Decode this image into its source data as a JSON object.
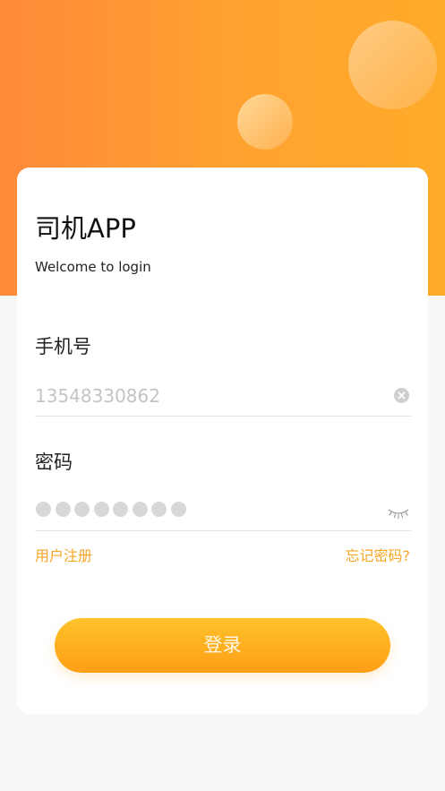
{
  "app": {
    "title": "司机APP",
    "subtitle": "Welcome to login"
  },
  "form": {
    "phone_label": "手机号",
    "phone_value": "13548330862",
    "password_label": "密码",
    "password_mask_count": 8
  },
  "links": {
    "register": "用户注册",
    "forgot": "忘记密码?"
  },
  "login_button": "登录",
  "icons": {
    "clear": "clear-icon",
    "password_toggle": "eye-closed-icon"
  },
  "colors": {
    "accent": "#f6a623",
    "header_gradient_start": "#ff8a3a",
    "header_gradient_end": "#ffab2a",
    "button_gradient_start": "#ffc22a",
    "button_gradient_end": "#ff9e16"
  }
}
